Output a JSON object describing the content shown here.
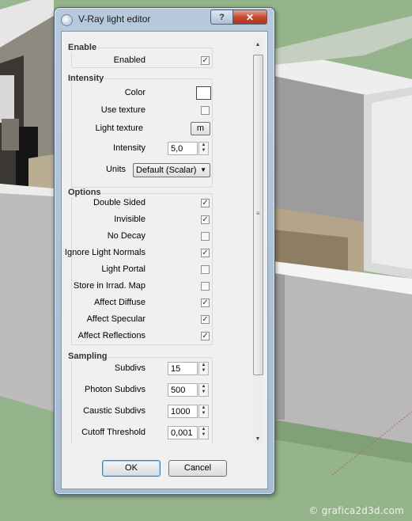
{
  "window": {
    "title": "V-Ray light editor",
    "help": "?",
    "close": "✕"
  },
  "groups": {
    "enable": {
      "title": "Enable",
      "enabled": {
        "label": "Enabled",
        "checked": true
      }
    },
    "intensity": {
      "title": "Intensity",
      "color_label": "Color",
      "color_value": "#ffffff",
      "use_texture": {
        "label": "Use texture",
        "checked": false
      },
      "light_texture_label": "Light texture",
      "light_texture_button": "m",
      "intensity_label": "Intensity",
      "intensity_value": "5,0",
      "units_label": "Units",
      "units_value": "Default (Scalar)"
    },
    "options": {
      "title": "Options",
      "items": [
        {
          "label": "Double Sided",
          "checked": true
        },
        {
          "label": "Invisible",
          "checked": true
        },
        {
          "label": "No Decay",
          "checked": false
        },
        {
          "label": "Ignore Light Normals",
          "checked": true
        },
        {
          "label": "Light Portal",
          "checked": false
        },
        {
          "label": "Store in Irrad. Map",
          "checked": false
        },
        {
          "label": "Affect Diffuse",
          "checked": true
        },
        {
          "label": "Affect Specular",
          "checked": true
        },
        {
          "label": "Affect Reflections",
          "checked": true
        }
      ]
    },
    "sampling": {
      "title": "Sampling",
      "fields": [
        {
          "label": "Subdivs",
          "value": "15"
        },
        {
          "label": "Photon Subdivs",
          "value": "500"
        },
        {
          "label": "Caustic Subdivs",
          "value": "1000"
        },
        {
          "label": "Cutoff Threshold",
          "value": "0,001"
        }
      ]
    }
  },
  "buttons": {
    "ok": "OK",
    "cancel": "Cancel"
  },
  "icons": {
    "check": "✓",
    "spin_up": "▲",
    "spin_down": "▼",
    "dropdown": "▼",
    "scroll_up": "▲",
    "scroll_down": "▼",
    "grip": "≡"
  },
  "watermark": "© grafica2d3d.com",
  "colors": {
    "titlebar": "#b7c9dc",
    "close_button": "#c2452d",
    "background_grass": "#94b48b"
  }
}
